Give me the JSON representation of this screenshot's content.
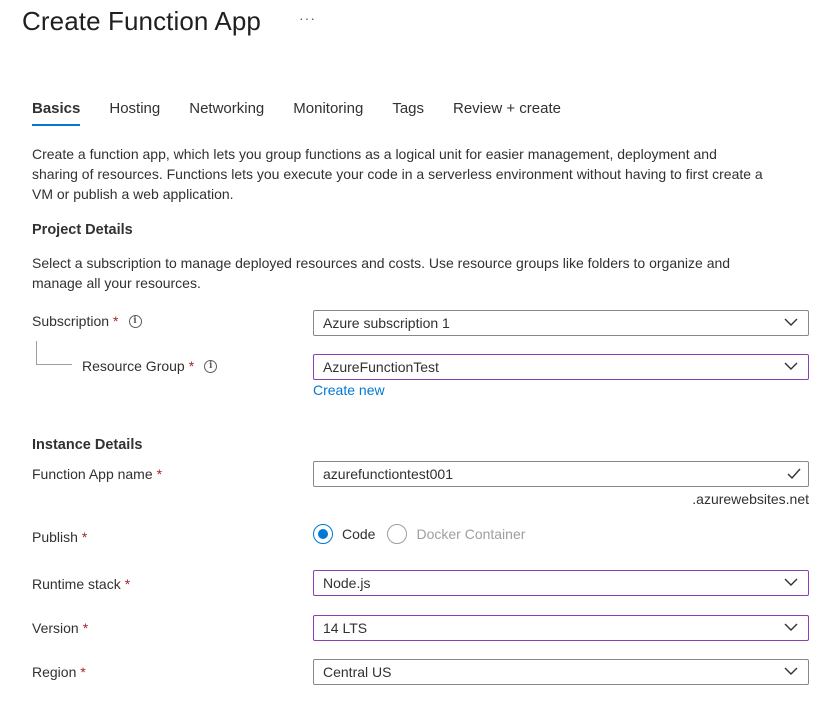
{
  "header": {
    "title": "Create Function App",
    "more_label": "···"
  },
  "tabs": [
    {
      "label": "Basics",
      "active": true
    },
    {
      "label": "Hosting"
    },
    {
      "label": "Networking"
    },
    {
      "label": "Monitoring"
    },
    {
      "label": "Tags"
    },
    {
      "label": "Review + create"
    }
  ],
  "intro": {
    "line1": "Create a function app, which lets you group functions as a logical unit for easier management, deployment and",
    "line2": "sharing of resources. Functions lets you execute your code in a serverless environment without having to first create a",
    "line3": "VM or publish a web application."
  },
  "project": {
    "title": "Project Details",
    "desc_line1": "Select a subscription to manage deployed resources and costs. Use resource groups like folders to organize and",
    "desc_line2": "manage all your resources.",
    "subscription": {
      "label": "Subscription",
      "value": "Azure subscription 1"
    },
    "resource_group": {
      "label": "Resource Group",
      "value": "AzureFunctionTest",
      "create_new": "Create new"
    }
  },
  "instance": {
    "title": "Instance Details",
    "app_name": {
      "label": "Function App name",
      "value": "azurefunctiontest001",
      "suffix": ".azurewebsites.net"
    },
    "publish": {
      "label": "Publish",
      "options": [
        "Code",
        "Docker Container"
      ],
      "selected": "Code"
    },
    "runtime": {
      "label": "Runtime stack",
      "value": "Node.js"
    },
    "version": {
      "label": "Version",
      "value": "14 LTS"
    },
    "region": {
      "label": "Region",
      "value": "Central US"
    }
  },
  "required_mark": "*",
  "info_glyph": "i",
  "colors": {
    "accent": "#0078d4",
    "required": "#a4262c",
    "focus_border": "#8a3fb5"
  }
}
